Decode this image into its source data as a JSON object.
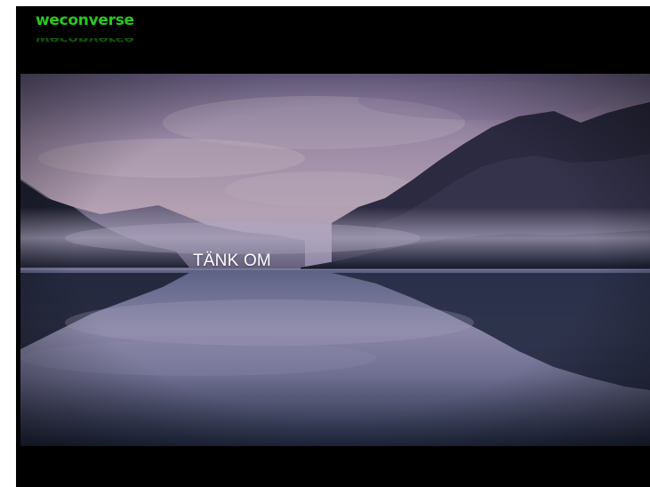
{
  "brand": {
    "name": "weconverse",
    "color": "#27c91e"
  },
  "hero": {
    "headline": "TÄNK OM",
    "image": "misty-mountain-lake-reflection"
  },
  "colors": {
    "background": "#000000",
    "headline": "#ffffff"
  }
}
